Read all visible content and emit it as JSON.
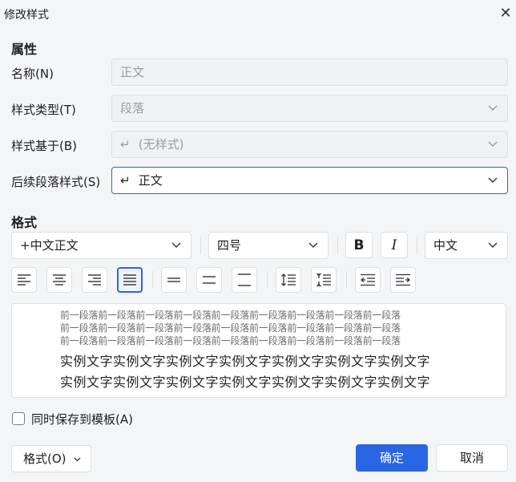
{
  "window": {
    "title": "修改样式"
  },
  "properties": {
    "section_title": "属性",
    "name_label": "名称(N)",
    "name_value": "正文",
    "style_type_label": "样式类型(T)",
    "style_type_value": "段落",
    "based_on_label": "样式基于(B)",
    "based_on_value": "(无样式)",
    "following_label": "后续段落样式(S)",
    "following_value": "正文"
  },
  "format": {
    "section_title": "格式",
    "font_name": "+中文正文",
    "font_size": "四号",
    "bold_label": "B",
    "italic_label": "I",
    "script_value": "中文"
  },
  "preview": {
    "previous_paragraph_line": "前一段落前一段落前一段落前一段落前一段落前一段落前一段落前一段落前一段落",
    "sample_line": "实例文字实例文字实例文字实例文字实例文字实例文字实例文字"
  },
  "footer": {
    "save_to_template": "同时保存到模板(A)",
    "format_button": "格式(O)",
    "ok_button": "确定",
    "cancel_button": "取消"
  },
  "colors": {
    "accent": "#2a66e3"
  }
}
